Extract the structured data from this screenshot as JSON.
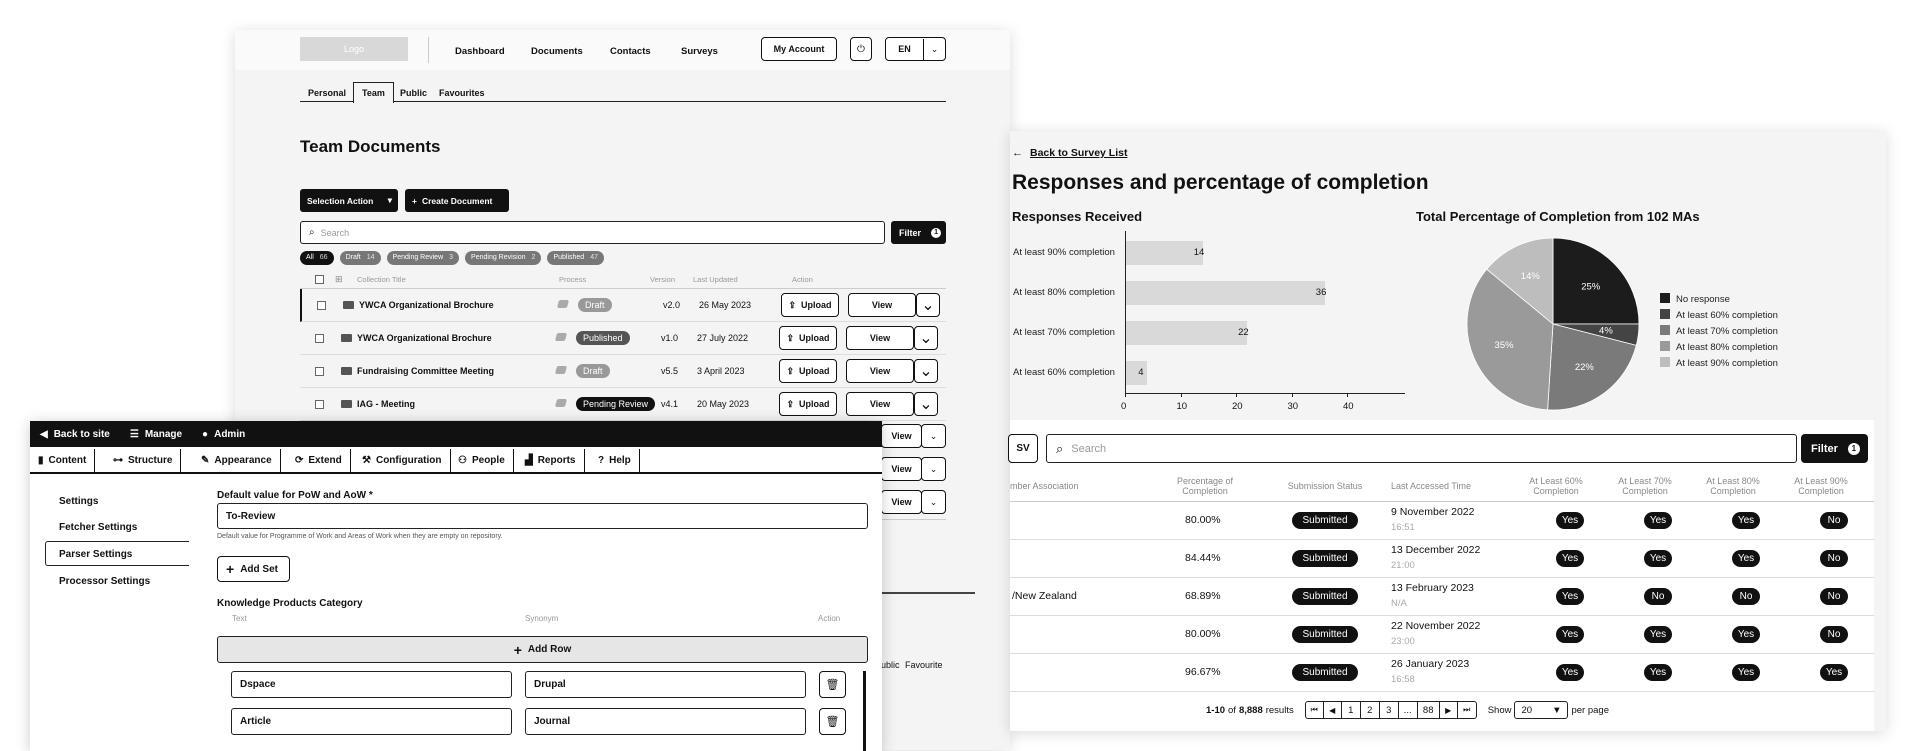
{
  "docs": {
    "logo": "Logo",
    "nav": [
      "Dashboard",
      "Documents",
      "Contacts",
      "Surveys"
    ],
    "my_account": "My Account",
    "lang": "EN",
    "tabs": [
      "Personal",
      "Team",
      "Public",
      "Favourites"
    ],
    "heading": "Team Documents",
    "selection_action": "Selection Action",
    "create_document": "Create Document",
    "search_placeholder": "Search",
    "filter": "Filter",
    "filter_count": "1",
    "status_filters": [
      {
        "label": "All",
        "count": "66"
      },
      {
        "label": "Draft",
        "count": "14"
      },
      {
        "label": "Pending Review",
        "count": "3"
      },
      {
        "label": "Pending Revision",
        "count": "2"
      },
      {
        "label": "Published",
        "count": "47"
      }
    ],
    "columns": [
      "Collection Title",
      "Process",
      "Version",
      "Last Updated",
      "Action"
    ],
    "rows": [
      {
        "title": "YWCA Organizational Brochure",
        "process": "Draft",
        "version": "v2.0",
        "updated": "26 May 2023"
      },
      {
        "title": "YWCA Organizational Brochure",
        "process": "Published",
        "version": "v1.0",
        "updated": "27 July 2022"
      },
      {
        "title": "Fundraising Committee Meeting",
        "process": "Draft",
        "version": "v5.5",
        "updated": "3 April 2023"
      },
      {
        "title": "IAG - Meeting",
        "process": "Pending Review",
        "version": "v4.1",
        "updated": "20 May 2023"
      }
    ],
    "upload": "Upload",
    "view": "View",
    "peek_public": "ublic",
    "peek_favourite": "Favourite"
  },
  "survey": {
    "back": "Back to Survey List",
    "title": "Responses and percentage of completion",
    "bar_title": "Responses Received",
    "pie_title": "Total Percentage of Completion from 102 MAs",
    "export": "SV",
    "search_placeholder": "Search",
    "filter": "Filter",
    "filter_count": "1",
    "columns": [
      "mber Association",
      "Percentage of Completion",
      "Submission Status",
      "Last Accessed Time",
      "At Least 60% Completion",
      "At Least 70% Completion",
      "At Least 80% Completion",
      "At Least 90% Completion"
    ],
    "rows": [
      {
        "name": "",
        "pct": "80.00%",
        "status": "Submitted",
        "date": "9 November 2022",
        "time": "16:51",
        "c": [
          "Yes",
          "Yes",
          "Yes",
          "No"
        ]
      },
      {
        "name": "",
        "pct": "84.44%",
        "status": "Submitted",
        "date": "13 December 2022",
        "time": "21:00",
        "c": [
          "Yes",
          "Yes",
          "Yes",
          "No"
        ]
      },
      {
        "name": "/New Zealand",
        "pct": "68.89%",
        "status": "Submitted",
        "date": "13 February 2023",
        "time": "N/A",
        "c": [
          "Yes",
          "No",
          "No",
          "No"
        ]
      },
      {
        "name": "",
        "pct": "80.00%",
        "status": "Submitted",
        "date": "22 November 2022",
        "time": "23:00",
        "c": [
          "Yes",
          "Yes",
          "Yes",
          "No"
        ]
      },
      {
        "name": "",
        "pct": "96.67%",
        "status": "Submitted",
        "date": "26 January 2023",
        "time": "16:58",
        "c": [
          "Yes",
          "Yes",
          "Yes",
          "Yes"
        ]
      }
    ],
    "pager": {
      "range": "1-10",
      "of": "of",
      "total": "8,888",
      "results": "results",
      "pages": [
        "1",
        "2",
        "3",
        "...",
        "88"
      ],
      "show": "Show",
      "per": "20",
      "per_page": "per page"
    }
  },
  "chart_data": [
    {
      "type": "bar",
      "title": "Responses Received",
      "categories": [
        "At least 90% completion",
        "At least 80% completion",
        "At least 70% completion",
        "At least 60% completion"
      ],
      "values": [
        14,
        36,
        22,
        4
      ],
      "xlim": [
        0,
        40
      ],
      "xticks": [
        0,
        10,
        20,
        30,
        40
      ]
    },
    {
      "type": "pie",
      "title": "Total Percentage of Completion from 102 MAs",
      "labels": [
        "No response",
        "At least 60% completion",
        "At least 70% completion",
        "At least 80% completion",
        "At least 90% completion"
      ],
      "values": [
        25,
        4,
        22,
        35,
        14
      ],
      "colors": [
        "#1c1c1c",
        "#444444",
        "#7a7a7a",
        "#9a9a9a",
        "#bdbdbd"
      ]
    }
  ],
  "admin": {
    "back": "Back to site",
    "manage": "Manage",
    "admin": "Admin",
    "tabs": [
      "Content",
      "Structure",
      "Appearance",
      "Extend",
      "Configuration",
      "People",
      "Reports",
      "Help"
    ],
    "sidebar": [
      "Settings",
      "Fetcher Settings",
      "Parser Settings",
      "Processor Settings"
    ],
    "field_label": "Default value for PoW and AoW *",
    "field_value": "To-Review",
    "field_help": "Default value for Programme of Work and Areas of Work when they are empty on repository.",
    "add_set": "Add Set",
    "category": "Knowledge Products Category",
    "columns": [
      "Text",
      "Synonym",
      "Action"
    ],
    "add_row": "Add Row",
    "rows": [
      {
        "text": "Dspace",
        "synonym": "Drupal"
      },
      {
        "text": "Article",
        "synonym": "Journal"
      }
    ]
  }
}
